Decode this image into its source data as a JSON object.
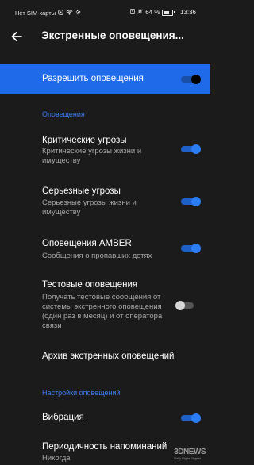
{
  "status_bar": {
    "carrier": "Нет SIM-карты",
    "battery": "64 %",
    "time": "13:36"
  },
  "app_bar": {
    "title": "Экстренные оповещения..."
  },
  "master": {
    "label": "Разрешить оповещения",
    "enabled": true
  },
  "section_alerts": {
    "header": "Оповещения",
    "items": [
      {
        "title": "Критические угрозы",
        "subtitle": "Критические угрозы жизни и имуществу",
        "enabled": true
      },
      {
        "title": "Серьезные угрозы",
        "subtitle": "Серьезные угрозы жизни и имуществу",
        "enabled": true
      },
      {
        "title": "Оповещения AMBER",
        "subtitle": "Сообщения о пропавших детях",
        "enabled": true
      },
      {
        "title": "Тестовые оповещения",
        "subtitle": "Получать тестовые сообщения от системы экстренного оповещения (один раз в месяц) и от оператора связи",
        "enabled": false
      }
    ],
    "archive_label": "Архив экстренных оповещений"
  },
  "section_settings": {
    "header": "Настройки оповещений",
    "vibration": {
      "title": "Вибрация",
      "enabled": true
    },
    "reminder": {
      "title": "Периодичность напоминаний",
      "value": "Никогда"
    }
  },
  "watermark": {
    "brand": "3DNEWS",
    "tagline": "Daily Digital Digest"
  },
  "colors": {
    "background": "#1b1b1b",
    "accent": "#1f6ae8",
    "section_header": "#3d7df2",
    "toggle_on": "#2c7cf3"
  }
}
